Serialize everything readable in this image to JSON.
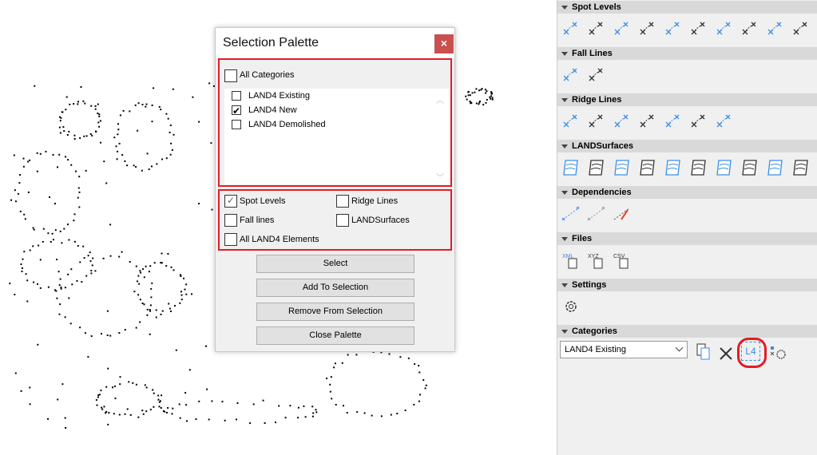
{
  "dialog": {
    "title": "Selection Palette",
    "close_label": "×",
    "all_categories": {
      "label": "All Categories",
      "checked": false
    },
    "categories": [
      {
        "label": "LAND4 Existing",
        "checked": false
      },
      {
        "label": "LAND4 New",
        "checked": true
      },
      {
        "label": "LAND4 Demolished",
        "checked": false
      }
    ],
    "element_types": [
      {
        "label": "Spot Levels",
        "checked": true
      },
      {
        "label": "Ridge Lines",
        "checked": false
      },
      {
        "label": "Fall lines",
        "checked": false
      },
      {
        "label": "LANDSurfaces",
        "checked": false
      },
      {
        "label": "All LAND4 Elements",
        "checked": false
      }
    ],
    "buttons": [
      "Select",
      "Add To Selection",
      "Remove From Selection",
      "Close Palette"
    ]
  },
  "panel": {
    "sections": [
      {
        "title": "Spot Levels",
        "icons": [
          "spot-level-label-icon",
          "spot-level-multi-icon",
          "spot-level-cluster-icon",
          "spot-level-cone-icon",
          "spot-level-plane-icon",
          "spot-level-surface-icon",
          "spot-level-box-icon",
          "spot-level-line-icon",
          "spot-level-fall-icon",
          "spot-level-edit-icon"
        ]
      },
      {
        "title": "Fall Lines",
        "icons": [
          "fall-line-icon",
          "fall-line-edit-icon"
        ]
      },
      {
        "title": "Ridge Lines",
        "icons": [
          "ridge-line-icon",
          "ridge-contour-icon",
          "ridge-add-icon",
          "ridge-points-icon",
          "ridge-surface-icon",
          "ridge-surface-fill-icon",
          "ridge-edit-icon"
        ]
      },
      {
        "title": "LANDSurfaces",
        "icons": [
          "surface-points-icon",
          "surface-center-icon",
          "surface-raise-icon",
          "surface-cross-icon",
          "surface-mesh-add-icon",
          "surface-dots-add-icon",
          "surface-grid-icon",
          "surface-layers-icon",
          "surface-sum-icon",
          "surface-edit-icon"
        ]
      },
      {
        "title": "Dependencies",
        "icons": [
          "dependency-link-icon",
          "dependency-link-gray-icon",
          "dependency-remove-icon"
        ]
      },
      {
        "title": "Files",
        "icons": [
          "xml-import-icon",
          "xyz-file-icon",
          "csv-save-icon"
        ]
      },
      {
        "title": "Settings",
        "icons": [
          "gear-icon"
        ]
      },
      {
        "title": "Categories",
        "icons": []
      }
    ],
    "category_select": "LAND4 Existing",
    "category_icons": [
      "category-list-icon",
      "category-hide-icon",
      "l4-category-icon",
      "category-settings-icon"
    ],
    "l4_label": "L4"
  },
  "colors": {
    "accent": "#3a8ee6",
    "highlight": "#e21c24",
    "close": "#c9504f"
  }
}
